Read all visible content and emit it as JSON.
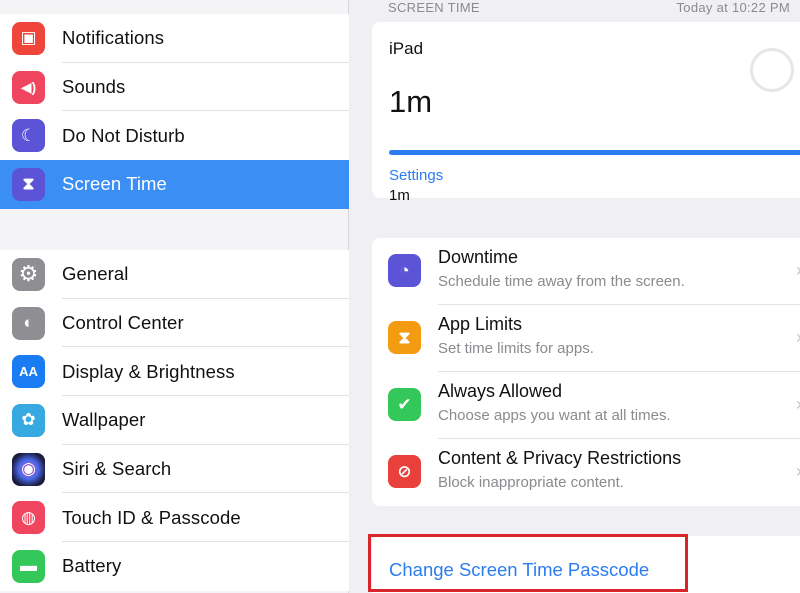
{
  "sidebar": {
    "group1": [
      {
        "label": "Notifications",
        "icon": "notifications-icon",
        "color": "#f0453a",
        "glyph": "▣"
      },
      {
        "label": "Sounds",
        "icon": "speaker-icon",
        "color": "#f0455e",
        "glyph": "🔊"
      },
      {
        "label": "Do Not Disturb",
        "icon": "moon-icon",
        "color": "#5b54d6",
        "glyph": "☾"
      },
      {
        "label": "Screen Time",
        "icon": "hourglass-icon",
        "color": "#5b54d6",
        "glyph": "⧗"
      }
    ],
    "group2": [
      {
        "label": "General",
        "icon": "gear-icon",
        "color": "#8e8e93",
        "glyph": "⚙"
      },
      {
        "label": "Control Center",
        "icon": "toggles-icon",
        "color": "#8e8e93",
        "glyph": "◐"
      },
      {
        "label": "Display & Brightness",
        "icon": "text-size-icon",
        "color": "#1a7cf2",
        "glyph": "AA"
      },
      {
        "label": "Wallpaper",
        "icon": "flower-icon",
        "color": "#35a9e0",
        "glyph": "✿"
      },
      {
        "label": "Siri & Search",
        "icon": "siri-icon",
        "color": "#2a2a5e",
        "glyph": "◉"
      },
      {
        "label": "Touch ID & Passcode",
        "icon": "fingerprint-icon",
        "color": "#f0455e",
        "glyph": "◍"
      },
      {
        "label": "Battery",
        "icon": "battery-icon",
        "color": "#34c759",
        "glyph": "▬"
      }
    ]
  },
  "main": {
    "section_header": "SCREEN TIME",
    "timestamp": "Today at 10:22 PM",
    "usage": {
      "device": "iPad",
      "total": "1m",
      "bar_fill_fraction": 1.0,
      "category": "Settings",
      "category_time": "1m"
    },
    "features": [
      {
        "title": "Downtime",
        "subtitle": "Schedule time away from the screen.",
        "icon": "downtime-icon",
        "color": "#5b54d6",
        "glyph": "◔"
      },
      {
        "title": "App Limits",
        "subtitle": "Set time limits for apps.",
        "icon": "hourglass-icon",
        "color": "#f39c12",
        "glyph": "⧗"
      },
      {
        "title": "Always Allowed",
        "subtitle": "Choose apps you want at all times.",
        "icon": "check-badge-icon",
        "color": "#34c759",
        "glyph": "✔"
      },
      {
        "title": "Content & Privacy Restrictions",
        "subtitle": "Block inappropriate content.",
        "icon": "no-entry-icon",
        "color": "#e8403a",
        "glyph": "⊘"
      }
    ],
    "passcode_link": "Change Screen Time Passcode"
  },
  "colors": {
    "accent": "#2b7cf2",
    "selected": "#3a8ef4",
    "highlight_box": "#d8252b"
  }
}
